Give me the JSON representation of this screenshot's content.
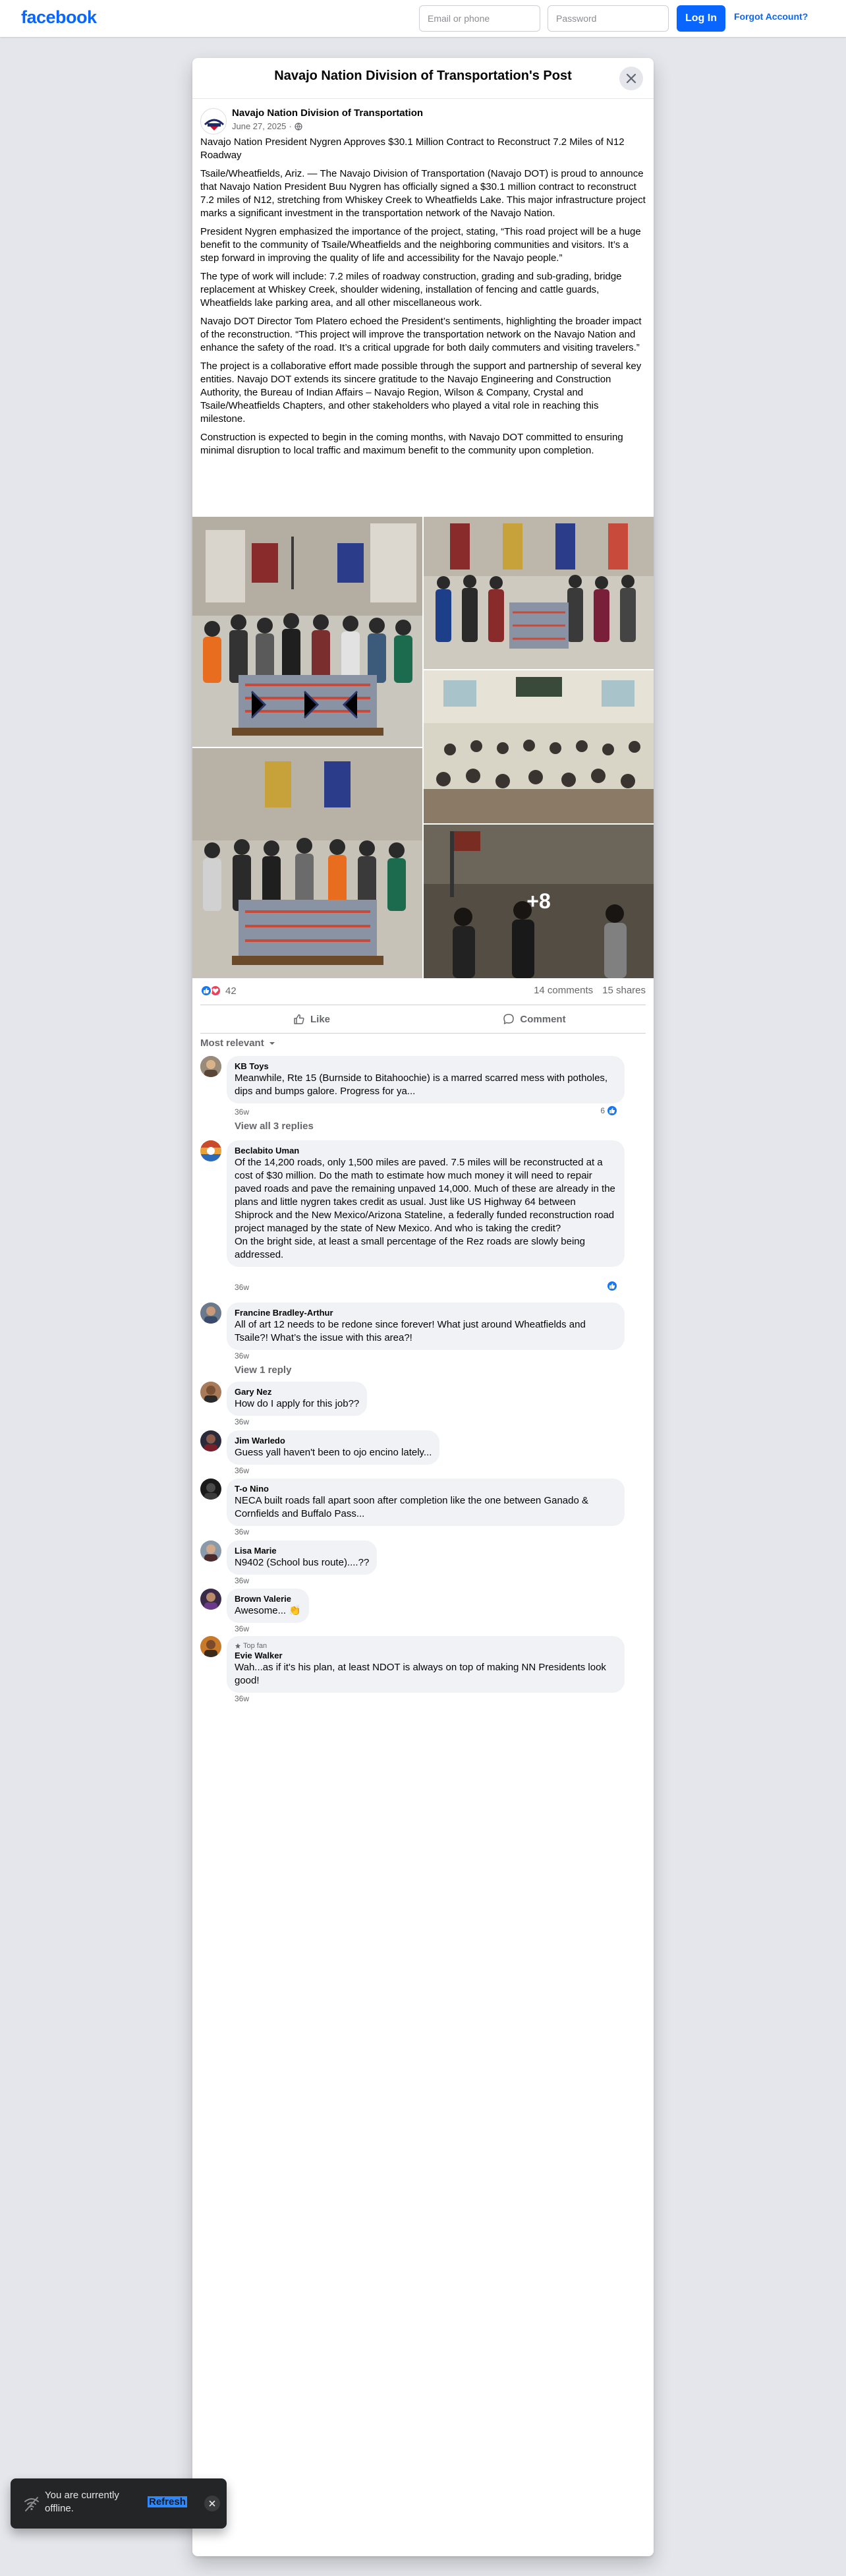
{
  "topbar": {
    "logo": "facebook",
    "email_placeholder": "Email or phone",
    "password_placeholder": "Password",
    "login_label": "Log In",
    "forgot_label": "Forgot Account?"
  },
  "modal": {
    "title": "Navajo Nation Division of Transportation's Post"
  },
  "post": {
    "author": "Navajo Nation Division of Transportation",
    "date": "June 27, 2025",
    "paragraphs": [
      "Navajo Nation President Nygren Approves $30.1 Million Contract to Reconstruct 7.2 Miles of N12 Roadway",
      "Tsaile/Wheatfields, Ariz. — The Navajo Division of Transportation (Navajo DOT) is proud to announce that Navajo Nation President Buu Nygren has officially signed a $30.1 million contract to reconstruct 7.2 miles of N12, stretching from Whiskey Creek to Wheatfields Lake. This major infrastructure project marks a significant investment in the transportation network of the Navajo Nation.",
      "President Nygren emphasized the importance of the project, stating, “This road project will be a huge benefit to the community of Tsaile/Wheatfields and the neighboring communities and visitors. It’s a step forward in improving the quality of life and accessibility for the Navajo people.”",
      "The type of work will include: 7.2 miles of roadway construction, grading and sub-grading, bridge replacement at Whiskey Creek, shoulder widening, installation of fencing and cattle guards, Wheatfields lake parking area, and all other miscellaneous work.",
      "Navajo DOT Director Tom Platero echoed the President’s sentiments, highlighting the broader impact of the reconstruction. “This project will improve the transportation network on the Navajo Nation and enhance the safety of the road. It’s a critical upgrade for both daily commuters and visiting travelers.”",
      "The project is a collaborative effort made possible through the support and partnership of several key entities. Navajo DOT extends its sincere gratitude to the Navajo Engineering and Construction Authority, the Bureau of Indian Affairs – Navajo Region, Wilson & Company, Crystal and Tsaile/Wheatfields Chapters, and other stakeholders who played a vital role in reaching this milestone.",
      "Construction is expected to begin in the coming months, with Navajo DOT committed to ensuring minimal disruption to local traffic and maximum benefit to the community upon completion."
    ],
    "more_photos": "+8",
    "reaction_count": "42",
    "comments_count": "14 comments",
    "shares_count": "15 shares",
    "like_label": "Like",
    "comment_label": "Comment",
    "sort_label": "Most relevant"
  },
  "comments": [
    {
      "name": "KB Toys",
      "text": "Meanwhile, Rte 15 (Burnside to Bitahoochie) is a marred scarred mess with potholes, dips and bumps galore. Progress for ya...",
      "time": "36w",
      "reactions": "6",
      "replies": "View all 3 replies"
    },
    {
      "name": "Beclabito Uman",
      "text": "Of the 14,200 roads, only 1,500 miles are paved. 7.5 miles will be reconstructed at a cost of $30 million. Do the math to estimate how much money it will need to repair paved roads and pave the remaining unpaved 14,000. Much of these are already in the plans and little nygren takes credit as usual. Just like US Highway 64 between Shiprock and the New Mexico/Arizona Stateline, a federally funded reconstruction road project managed by the state of New Mexico. And who is taking the credit?\nOn the bright side, at least a small percentage of the Rez roads are slowly being addressed.",
      "time": "36w"
    },
    {
      "name": "Francine Bradley-Arthur",
      "text": "All of art 12 needs to be redone since forever! What just around Wheatfields and Tsaile?! What’s the issue with this area?!",
      "time": "36w",
      "replies": "View 1 reply"
    },
    {
      "name": "Gary Nez",
      "text": "How do I apply for this job??",
      "time": "36w"
    },
    {
      "name": "Jim Warledo",
      "text": "Guess yall haven't been to ojo encino lately...",
      "time": "36w"
    },
    {
      "name": "T-o Nino",
      "text": "NECA built roads fall apart soon after completion like the one between Ganado & Cornfields and Buffalo Pass...",
      "time": "36w"
    },
    {
      "name": "Lisa Marie",
      "text": "N9402 (School bus route)....??",
      "time": "36w"
    },
    {
      "name": "Brown Valerie",
      "text": "Awesome... 👏",
      "time": "36w"
    },
    {
      "name": "Evie Walker",
      "badge": "Top fan",
      "text": "Wah...as if it's his plan, at least NDOT is always on top of making NN Presidents look good!",
      "time": "36w"
    }
  ],
  "toast": {
    "text": "You are currently offline.",
    "refresh": "Refresh"
  }
}
